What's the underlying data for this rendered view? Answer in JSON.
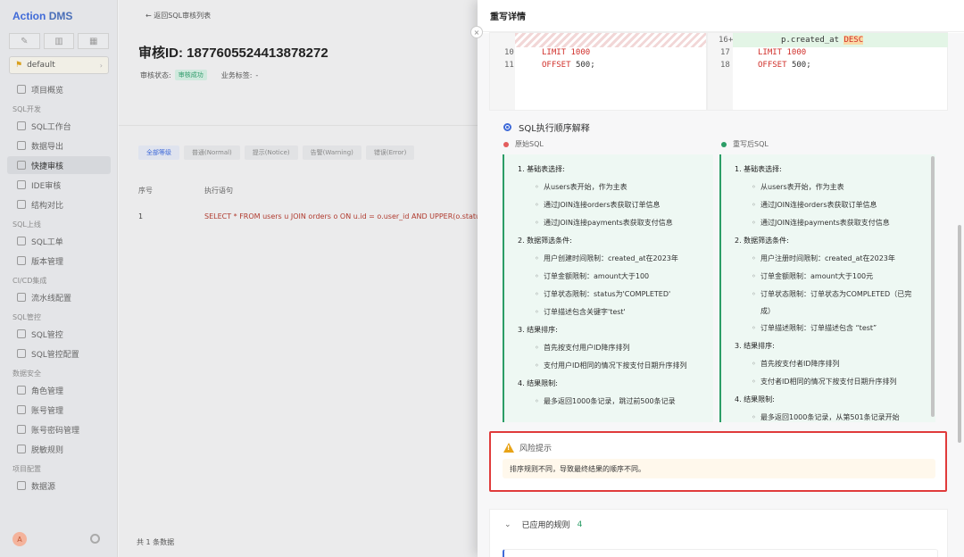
{
  "app": {
    "logo_action": "Action",
    "logo_dms": "DMS"
  },
  "project": {
    "name": "default"
  },
  "nav": [
    {
      "type": "item",
      "label": "项目概览"
    },
    {
      "type": "group",
      "label": "SQL开发"
    },
    {
      "type": "item",
      "label": "SQL工作台"
    },
    {
      "type": "item",
      "label": "数据导出"
    },
    {
      "type": "item",
      "label": "快捷审核",
      "active": true
    },
    {
      "type": "item",
      "label": "IDE审核"
    },
    {
      "type": "item",
      "label": "结构对比"
    },
    {
      "type": "group",
      "label": "SQL上线"
    },
    {
      "type": "item",
      "label": "SQL工单"
    },
    {
      "type": "item",
      "label": "版本管理"
    },
    {
      "type": "group",
      "label": "CI/CD集成"
    },
    {
      "type": "item",
      "label": "流水线配置"
    },
    {
      "type": "group",
      "label": "SQL管控"
    },
    {
      "type": "item",
      "label": "SQL管控"
    },
    {
      "type": "item",
      "label": "SQL管控配置"
    },
    {
      "type": "group",
      "label": "数据安全"
    },
    {
      "type": "item",
      "label": "角色管理"
    },
    {
      "type": "item",
      "label": "账号管理"
    },
    {
      "type": "item",
      "label": "账号密码管理"
    },
    {
      "type": "item",
      "label": "脱敏规则"
    },
    {
      "type": "group",
      "label": "项目配置"
    },
    {
      "type": "item",
      "label": "数据源"
    }
  ],
  "user": {
    "avatar_letter": "A"
  },
  "main": {
    "back_label": "返回SQL审核列表",
    "title": "审核ID: 1877605524413878272",
    "status_label": "审核状态:",
    "status_value": "审核成功",
    "tags_label": "业务标签:",
    "tags_value": "-",
    "filter_tabs": [
      "全部等级",
      "普通(Normal)",
      "提示(Notice)",
      "告警(Warning)",
      "错误(Error)"
    ],
    "table_headers": [
      "序号",
      "执行语句"
    ],
    "rows": [
      {
        "index": "1",
        "sql": "SELECT * FROM users u JOIN orders o ON u.id = o.user_id AND UPPER(o.status) ="
      }
    ],
    "total": "共 1 条数据"
  },
  "drawer": {
    "title": "重写详情",
    "diff": {
      "left": [
        {
          "ln": "10",
          "kw": "LIMIT",
          "val": "1000"
        },
        {
          "ln": "11",
          "kw": "OFFSET",
          "val": "500;"
        }
      ],
      "right_top": {
        "ln": "16+",
        "text": "p.created_at",
        "kw": "DESC"
      },
      "right": [
        {
          "ln": "17",
          "kw": "LIMIT",
          "val": "1000"
        },
        {
          "ln": "18",
          "kw": "OFFSET",
          "val": "500;"
        }
      ]
    },
    "explain_title": "SQL执行顺序解释",
    "original_label": "原始SQL",
    "rewritten_label": "重写后SQL",
    "original_explain": [
      {
        "level": 1,
        "text": "1. 基础表选择:"
      },
      {
        "level": 2,
        "text": "从users表开始，作为主表"
      },
      {
        "level": 2,
        "text": "通过JOIN连接orders表获取订单信息"
      },
      {
        "level": 2,
        "text": "通过JOIN连接payments表获取支付信息"
      },
      {
        "level": 1,
        "text": "2. 数据筛选条件:"
      },
      {
        "level": 2,
        "text": "用户创建时间限制：created_at在2023年"
      },
      {
        "level": 2,
        "text": "订单金额限制：amount大于100"
      },
      {
        "level": 2,
        "text": "订单状态限制：status为'COMPLETED'"
      },
      {
        "level": 2,
        "text": "订单描述包含关键字'test'"
      },
      {
        "level": 1,
        "text": "3. 结果排序:"
      },
      {
        "level": 2,
        "text": "首先按支付用户ID降序排列"
      },
      {
        "level": 2,
        "text": "支付用户ID相同的情况下按支付日期升序排列"
      },
      {
        "level": 1,
        "text": "4. 结果限制:"
      },
      {
        "level": 2,
        "text": "最多返回1000条记录，跳过前500条记录"
      }
    ],
    "rewritten_explain": [
      {
        "level": 1,
        "text": "1. 基础表选择:"
      },
      {
        "level": 2,
        "text": "从users表开始，作为主表"
      },
      {
        "level": 2,
        "text": "通过JOIN连接orders表获取订单信息"
      },
      {
        "level": 2,
        "text": "通过JOIN连接payments表获取支付信息"
      },
      {
        "level": 1,
        "text": "2. 数据筛选条件:"
      },
      {
        "level": 2,
        "text": "用户注册时间限制：created_at在2023年"
      },
      {
        "level": 2,
        "text": "订单金额限制：amount大于100元"
      },
      {
        "level": 2,
        "text": "订单状态限制：订单状态为COMPLETED（已完"
      },
      {
        "level": 3,
        "text": "成）"
      },
      {
        "level": 2,
        "text": "订单描述限制：订单描述包含 “test”"
      },
      {
        "level": 1,
        "text": "3. 结果排序:"
      },
      {
        "level": 2,
        "text": "首先按支付者ID降序排列"
      },
      {
        "level": 2,
        "text": "支付者ID相同的情况下按支付日期升序排列"
      },
      {
        "level": 1,
        "text": "4. 结果限制:"
      },
      {
        "level": 2,
        "text": "最多返回1000条记录，从第501条记录开始"
      }
    ],
    "risk_title": "风险提示",
    "risk_message": "排序规则不同，导致最终结果的顺序不同。",
    "applied_rules_label": "已应用的规则",
    "applied_rules_count": "4"
  },
  "colors": {
    "accent": "#3f6ad8",
    "success": "#2b9d66",
    "danger": "#e03b3b",
    "warning": "#e8a317"
  }
}
